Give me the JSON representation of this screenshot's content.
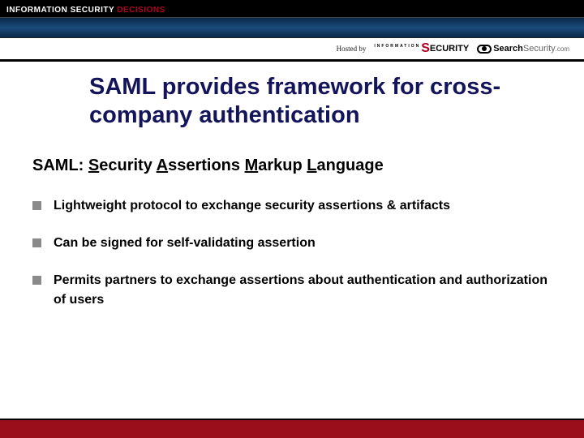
{
  "banner": {
    "brand_prefix": "INFORMATION SECURITY ",
    "brand_suffix": "DECISIONS"
  },
  "hosted": {
    "label": "Hosted by",
    "sponsor1_super": "INFORMATION",
    "sponsor1_s": "S",
    "sponsor1_rest": "ECURITY",
    "sponsor2_bold": "Search",
    "sponsor2_light": "Security",
    "sponsor2_com": ".com"
  },
  "title": "SAML provides framework for cross-company authentication",
  "subtitle": {
    "prefix": "SAML: ",
    "s": "S",
    "s_rest": "ecurity ",
    "a": "A",
    "a_rest": "ssertions ",
    "m": "M",
    "m_rest": "arkup ",
    "l": "L",
    "l_rest": "anguage"
  },
  "bullets": [
    "Lightweight protocol to exchange security assertions & artifacts",
    "Can be signed for self-validating assertion",
    "Permits partners to exchange assertions about authentication and authorization of users"
  ]
}
